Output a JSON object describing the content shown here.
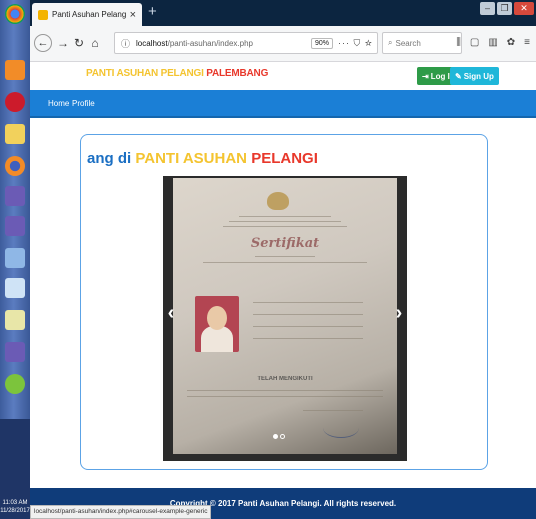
{
  "taskbar": {
    "icons": [
      "chrome-icon",
      "app-icon",
      "opera-icon",
      "folder-icon",
      "firefox-icon",
      "vs-icon",
      "vs-icon",
      "network-icon",
      "notepad-icon",
      "notepad-icon",
      "vs-icon",
      "green-app-icon"
    ],
    "clock": "11:03 AM",
    "date": "11/28/2017"
  },
  "browser": {
    "tab_title": "Panti Asuhan Pelangi",
    "tab_close": "×",
    "new_tab": "+",
    "url_info": "ⓘ",
    "url_host": "localhost",
    "url_path": "/panti-asuhan/index.php",
    "zoom": "90%",
    "url_actions": "··· ⛉ ☆",
    "search_placeholder": "Search",
    "status_url": "localhost/panti-asuhan/index.php#carousel-example-generic"
  },
  "site": {
    "brand_a": "PANTI ASUHAN PELANGI ",
    "brand_b": "PALEMBANG",
    "login_label": "Log In",
    "signup_label": "Sign Up",
    "nav": [
      "Home",
      "Profile"
    ],
    "welcome_a": "ang di ",
    "welcome_b": "PANTI ASUHAN ",
    "welcome_c": "PELANGI",
    "cert_title": "Sertifikat",
    "cert_heading": "TELAH MENGIKUTI",
    "footer": "Copyright © 2017 Panti Asuhan Pelangi. All rights reserved."
  },
  "colors": {
    "nav_blue": "#1b7fd6",
    "footer_blue": "#0f3c7a",
    "brand_yellow": "#f4c430",
    "brand_red": "#e8382b",
    "login_green": "#2e9b48",
    "signup_cyan": "#1fb7d9"
  }
}
